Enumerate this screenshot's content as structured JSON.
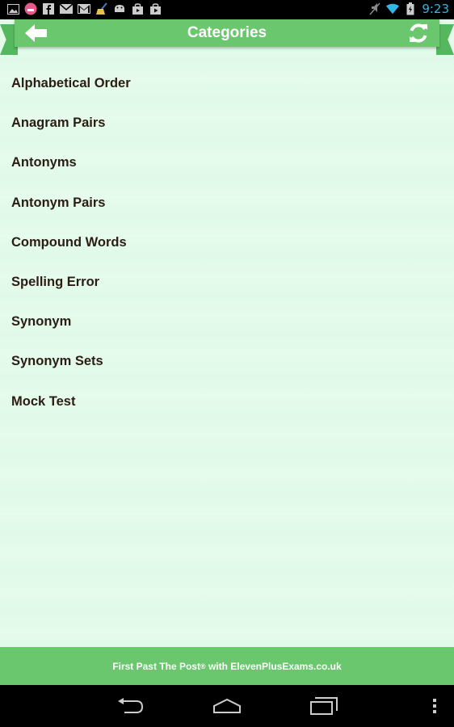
{
  "status_bar": {
    "time": "9:23",
    "left_icons": [
      "gallery-icon",
      "emoji-icon",
      "facebook-icon",
      "mail-icon",
      "gmail-icon",
      "broom-icon",
      "android-icon",
      "bag-icon",
      "play-store-icon"
    ],
    "right_icons": [
      "mute-icon",
      "wifi-icon",
      "battery-icon"
    ]
  },
  "header": {
    "title": "Categories",
    "back_icon": "arrow-left-icon",
    "refresh_icon": "refresh-icon"
  },
  "categories": [
    {
      "label": "Alphabetical Order"
    },
    {
      "label": "Anagram Pairs"
    },
    {
      "label": "Antonyms"
    },
    {
      "label": "Antonym Pairs"
    },
    {
      "label": "Compound Words"
    },
    {
      "label": "Spelling Error"
    },
    {
      "label": "Synonym"
    },
    {
      "label": "Synonym Sets"
    },
    {
      "label": "Mock Test"
    }
  ],
  "footer": {
    "prefix": "First Past The Post",
    "registered": "®",
    "suffix": " with ElevenPlusExams.co.uk"
  },
  "nav_bar": {
    "icons": [
      "back-icon",
      "home-icon",
      "recent-apps-icon",
      "overflow-menu-icon"
    ]
  },
  "colors": {
    "header_green": "#6ac76e",
    "ribbon_dark": "#55b85f",
    "list_bg": "#e2faea",
    "text_dark": "#2b1d14",
    "time_blue": "#33b5e5"
  }
}
